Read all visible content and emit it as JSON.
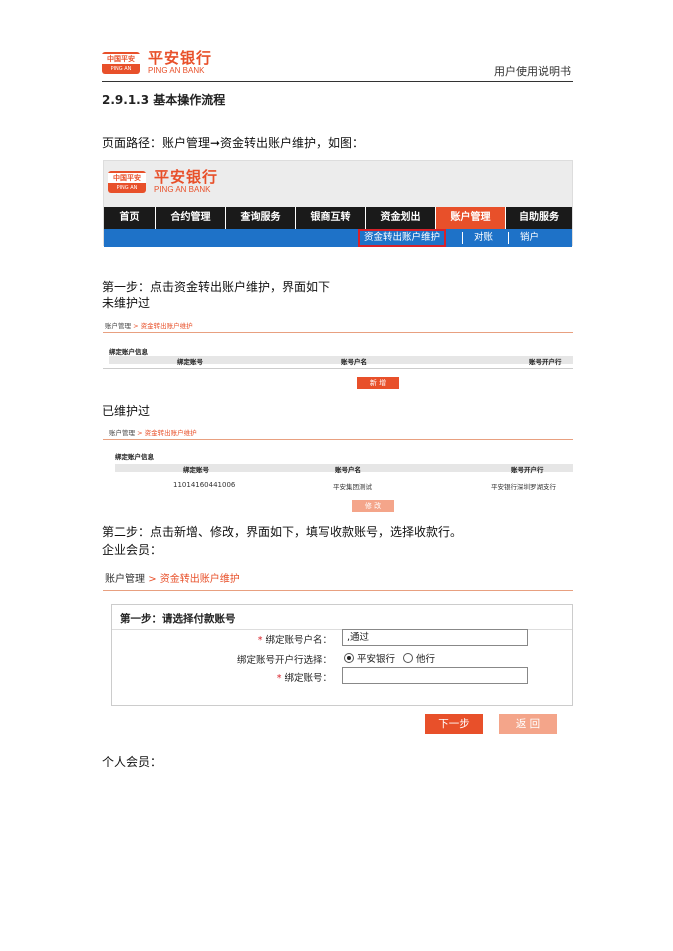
{
  "header": {
    "logo_seal_top": "中国平安",
    "logo_seal_bottom": "PING AN",
    "logo_cn": "平安银行",
    "logo_en": "PING AN BANK",
    "manual_title": "用户使用说明书"
  },
  "section_title": "2.9.1.3 基本操作流程",
  "paragraphs": {
    "path": "页面路径：账户管理➞资金转出账户维护，如图：",
    "step1": "第一步：点击资金转出账户维护，界面如下",
    "not_maintained": "未维护过",
    "maintained": "已维护过",
    "step2": "第二步：点击新增、修改，界面如下，填写收款账号，选择收款行。",
    "corporate": "企业会员：",
    "personal": "个人会员："
  },
  "nav": {
    "menu": [
      "首页",
      "合约管理",
      "查询服务",
      "银商互转",
      "资金划出",
      "账户管理",
      "自助服务"
    ],
    "active_menu": "账户管理",
    "sub": [
      "资金转出账户维护",
      "对账",
      "销户"
    ]
  },
  "mini_unmaintained": {
    "crumb_root": "账户管理",
    "crumb_sep": ">",
    "crumb_current": "资金转出账户维护",
    "section_label": "绑定账户信息",
    "columns": [
      "绑定账号",
      "账号户名",
      "账号开户行"
    ],
    "button": "新 增"
  },
  "mini_maintained": {
    "crumb_root": "账户管理",
    "crumb_sep": ">",
    "crumb_current": "资金转出账户维护",
    "section_label": "绑定账户信息",
    "columns": [
      "绑定账号",
      "账号户名",
      "账号开户行"
    ],
    "row": [
      "11014160441006",
      "平安集团测试",
      "平安银行深圳罗湖支行"
    ],
    "button": "修 改"
  },
  "form": {
    "crumb_root": "账户管理",
    "crumb_sep": ">",
    "crumb_current": "资金转出账户维护",
    "step_title": "第一步：请选择付款账号",
    "fields": {
      "account_name_label": "绑定账号户名：",
      "account_name_value": ",通过",
      "bank_select_label": "绑定账号开户行选择：",
      "bank_option_1": "平安银行",
      "bank_option_2": "他行",
      "account_no_label": "绑定账号：",
      "account_no_value": ""
    },
    "required_mark": "*",
    "next_button": "下一步",
    "back_button": "返 回"
  },
  "colors": {
    "brand_orange": "#e8502a",
    "menu_black": "#1a1a1a",
    "sub_blue": "#1e72c8",
    "highlight_red": "#d8222a",
    "button_pale": "#f4a58a"
  }
}
